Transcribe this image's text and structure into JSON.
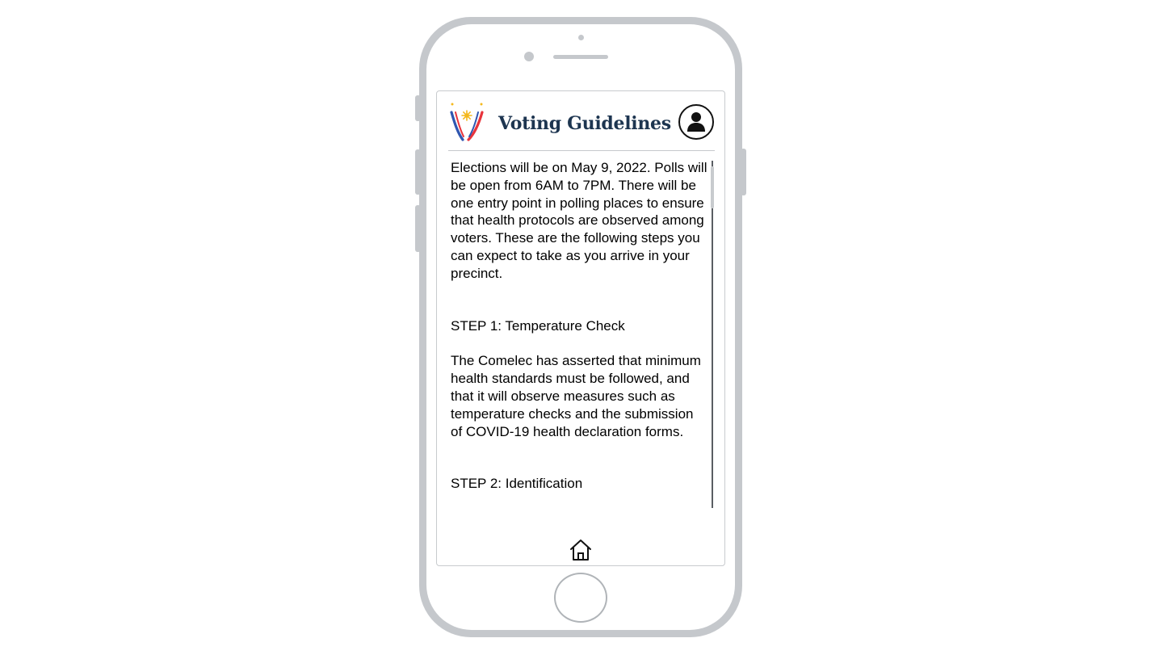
{
  "app": {
    "title": "Voting Guidelines",
    "title_color": "#1d3550"
  },
  "header": {
    "logo_icon": "ph-flag-v-logo-icon",
    "profile_icon": "user-icon"
  },
  "content": {
    "intro": "Elections will be on May 9, 2022. Polls will be open from 6AM to 7PM. There will be one entry point in polling places to ensure that health protocols are observed among voters. These are the following steps you can expect to take as you arrive in your precinct.",
    "step1_title": "STEP 1: Temperature Check",
    "step1_body": "The Comelec has asserted that minimum health standards must be followed, and that it will observe measures such as temperature checks and the submission of COVID-19 health declaration forms.",
    "step2_title": "STEP 2: Identification"
  },
  "footer": {
    "home_icon": "home-icon"
  },
  "colors": {
    "frame": "#c5c8cc",
    "logo_blue": "#2f56b0",
    "logo_red": "#e8343c",
    "logo_yellow": "#f4b81c"
  }
}
